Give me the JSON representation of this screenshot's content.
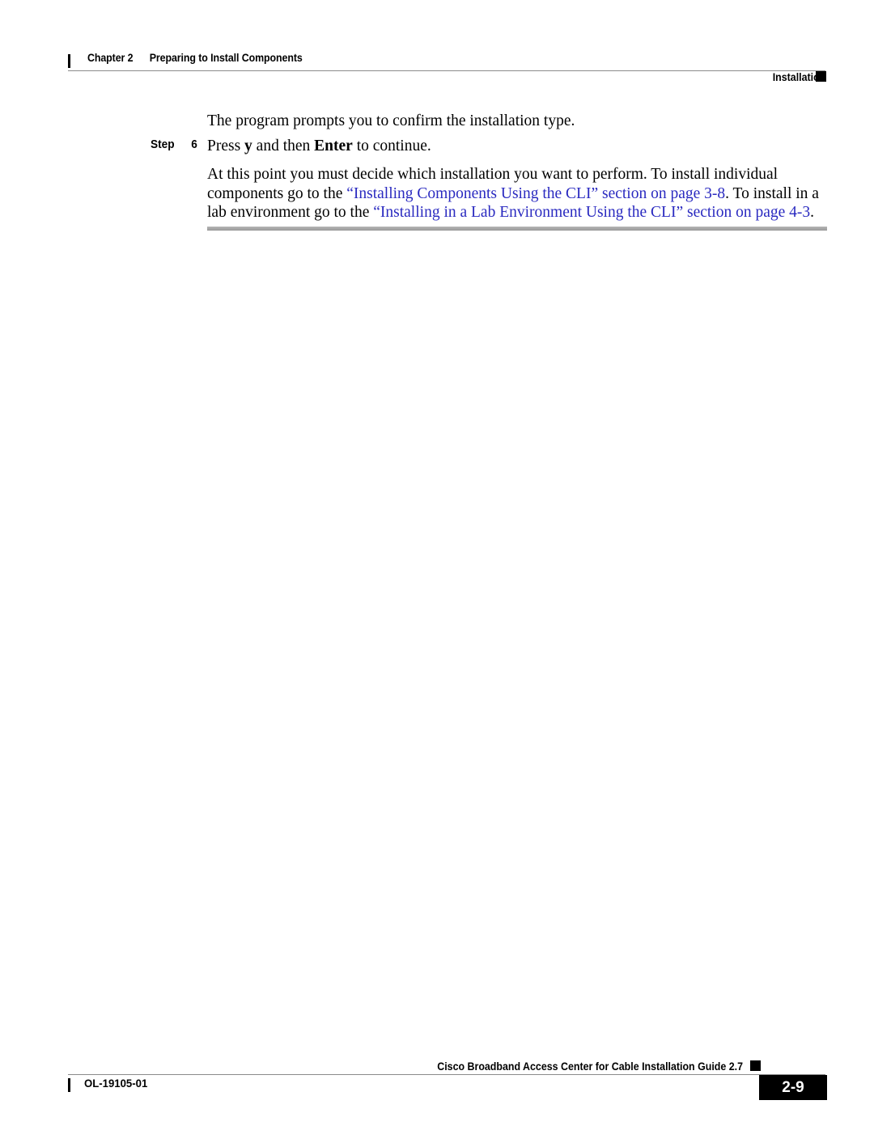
{
  "document": {
    "header": {
      "chapter_label": "Chapter 2",
      "chapter_title": "Preparing to Install Components",
      "section_title": "Installation"
    },
    "body": {
      "intro_paragraph": "The program prompts you to confirm the installation type.",
      "step": {
        "label": "Step",
        "number": "6",
        "text_before_key1": "Press ",
        "key1": "y",
        "text_between_keys": " and then ",
        "key2": "Enter",
        "text_after_key2": " to continue."
      },
      "detail_paragraph": {
        "segment_1": "At this point you must decide which installation you want to perform. To install individual components go to the ",
        "link_1": "“Installing Components Using the CLI” section on page 3-8",
        "segment_2": ". To install in a lab environment go to the ",
        "link_2": "“Installing in a Lab Environment Using the CLI” section on page 4-3",
        "segment_3": "."
      }
    },
    "footer": {
      "guide_title": "Cisco Broadband Access Center for Cable Installation Guide 2.7",
      "document_id": "OL-19105-01",
      "page_number": "2-9"
    },
    "colors": {
      "link": "#2a2ac0",
      "text": "#000000",
      "rule": "#8b8b8b",
      "body_rule": "#a8a8a8",
      "page_background": "#ffffff",
      "marker": "#000000"
    }
  }
}
